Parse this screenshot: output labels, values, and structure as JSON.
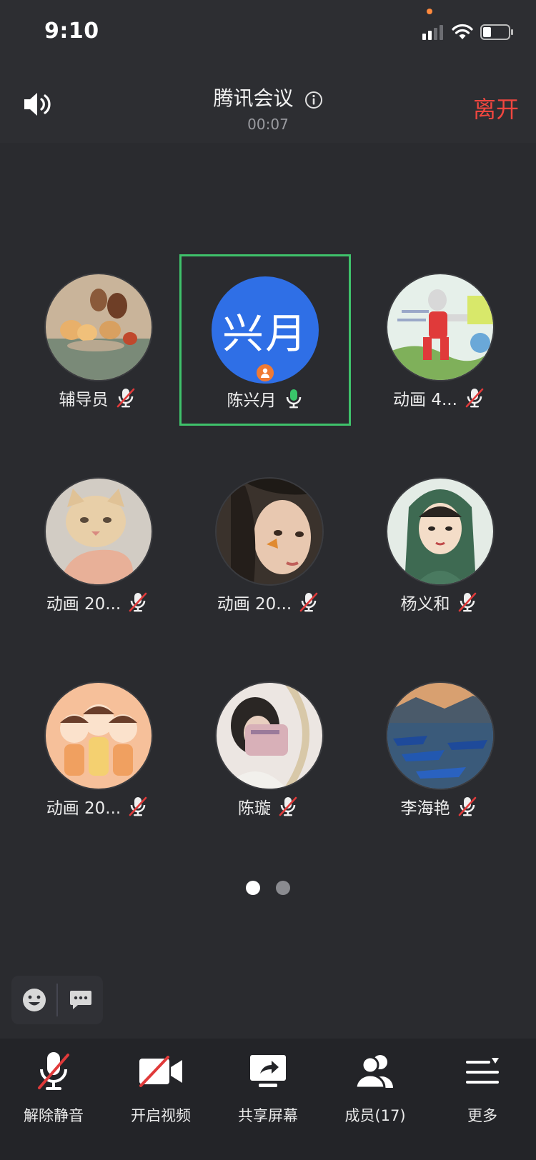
{
  "status_bar": {
    "time": "9:10"
  },
  "header": {
    "title": "腾讯会议",
    "timer": "00:07",
    "leave_label": "离开"
  },
  "participants": [
    {
      "name": "辅导员",
      "mic": "muted",
      "avatar": "still-life-painting"
    },
    {
      "name": "陈兴月",
      "mic": "on",
      "avatar_initials": "兴月",
      "host": true,
      "speaking": true
    },
    {
      "name": "动画 4...",
      "mic": "muted",
      "avatar": "cartoon-hero"
    },
    {
      "name": "动画 20...",
      "mic": "muted",
      "avatar": "cat"
    },
    {
      "name": "动画 20...",
      "mic": "muted",
      "avatar": "portrait-butterfly"
    },
    {
      "name": "杨义和",
      "mic": "muted",
      "avatar": "illustrated-woman"
    },
    {
      "name": "动画 20...",
      "mic": "muted",
      "avatar": "cartoon-trio"
    },
    {
      "name": "陈璇",
      "mic": "muted",
      "avatar": "mirror-selfie"
    },
    {
      "name": "李海艳",
      "mic": "muted",
      "avatar": "boats-lake"
    }
  ],
  "pagination": {
    "pages": 2,
    "current": 1
  },
  "toolbar": {
    "unmute": "解除静音",
    "video": "开启视频",
    "share": "共享屏幕",
    "members": "成员(17)",
    "more": "更多"
  },
  "colors": {
    "leave": "#f0463f",
    "active_border": "#3fc26b",
    "avatar_blue": "#2f6fe6",
    "muted_red": "#e03a3a",
    "mic_green": "#39c46a"
  }
}
